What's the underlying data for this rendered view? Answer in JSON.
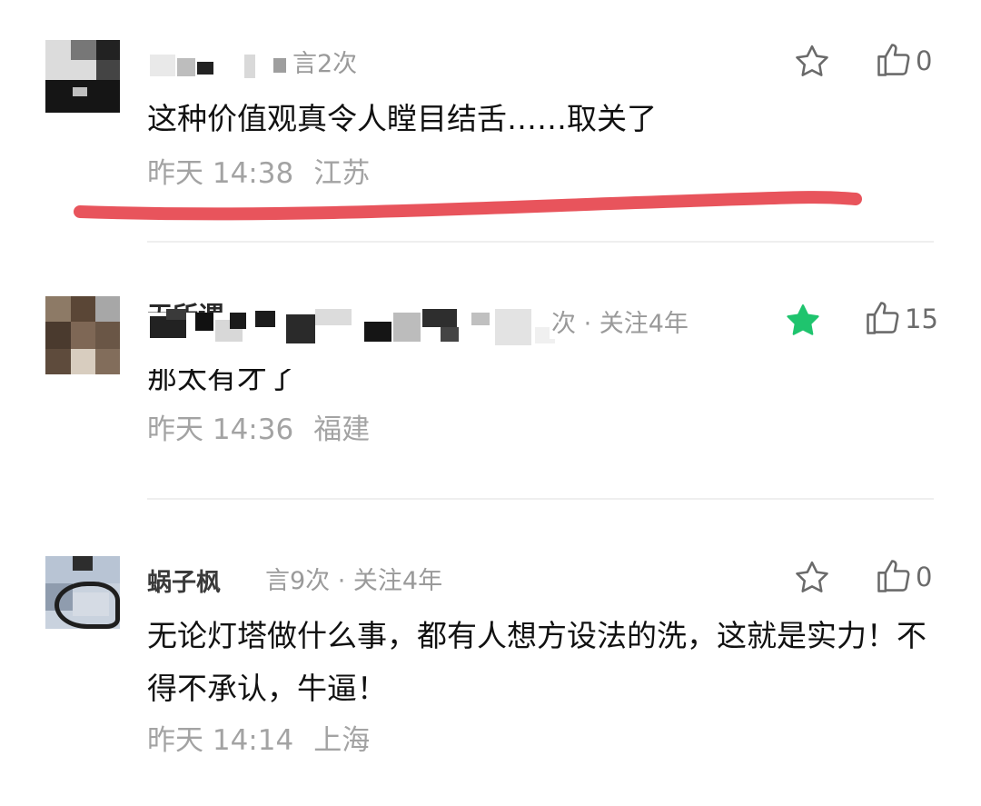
{
  "comments": [
    {
      "meta": "言2次",
      "text": "这种价值观真令人瞠目结舌……取关了",
      "time": "昨天 14:38",
      "location": "江苏",
      "starred": false,
      "likes": "0"
    },
    {
      "name_fragment": "无所谓",
      "meta": "次 · 关注4年",
      "text_fragment": "那太有才了",
      "time": "昨天 14:36",
      "location": "福建",
      "starred": true,
      "likes": "15"
    },
    {
      "name": "蜗子枫",
      "meta": "言9次 · 关注4年",
      "text": "无论灯塔做什么事，都有人想方设法的洗，这就是实力！不得不承认，牛逼！",
      "time": "昨天 14:14",
      "location": "上海",
      "starred": false,
      "likes": "0"
    }
  ],
  "colors": {
    "highlight_stroke": "#e8545c",
    "star_active": "#1fc46e",
    "meta_gray": "#9a9a9a"
  },
  "icons": [
    "star-icon",
    "thumbs-up-icon"
  ]
}
